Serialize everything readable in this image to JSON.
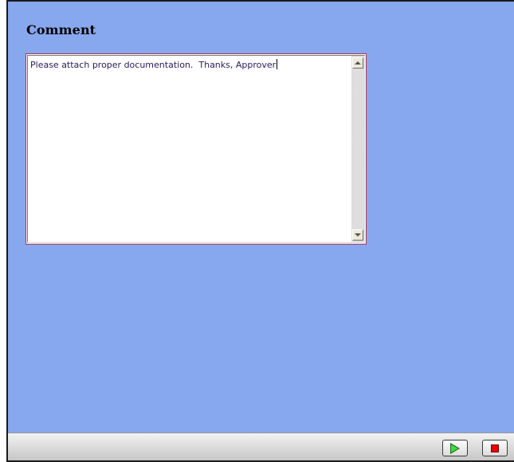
{
  "form": {
    "heading": "Comment",
    "comment_value": "Please attach proper documentation.  Thanks, Approver"
  },
  "controls": {
    "play_icon": "play-icon",
    "stop_icon": "stop-icon",
    "play_color": "#3ddc3d",
    "stop_color": "#ee0000"
  },
  "colors": {
    "background": "#87a7ee",
    "textarea_border": "#b0344a"
  }
}
